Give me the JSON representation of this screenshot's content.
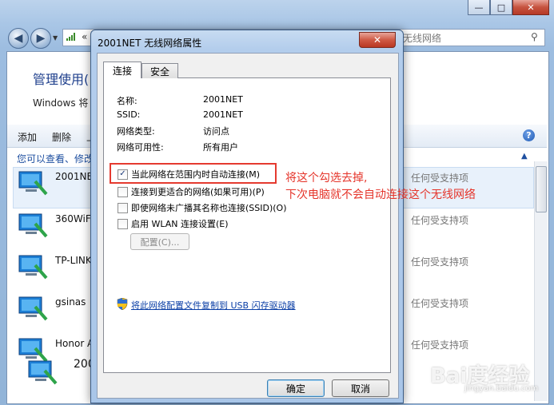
{
  "background": {
    "address_text": "«",
    "search_placeholder": "无线网络",
    "page_title": "管理使用(",
    "subtitle": "Windows 将",
    "toolbar": {
      "add": "添加",
      "remove": "删除",
      "more": "上"
    },
    "hint": "您可以查看、修改",
    "networks": [
      {
        "name": "2001NE",
        "status": "任何受支持项"
      },
      {
        "name": "360WiFi",
        "status": "任何受支持项"
      },
      {
        "name": "TP-LINK",
        "status": "任何受支持项"
      },
      {
        "name": "gsinas",
        "status": "任何受支持项"
      },
      {
        "name": "Honor A",
        "status": "任何受支持项"
      },
      {
        "name": "200",
        "status": ""
      }
    ]
  },
  "dialog": {
    "title": "2001NET 无线网络属性",
    "tabs": [
      "连接",
      "安全"
    ],
    "properties": [
      {
        "label": "名称:",
        "value": "2001NET"
      },
      {
        "label": "SSID:",
        "value": "2001NET"
      },
      {
        "label": "网络类型:",
        "value": "访问点"
      },
      {
        "label": "网络可用性:",
        "value": "所有用户"
      }
    ],
    "options": [
      {
        "label": "当此网络在范围内时自动连接(M)",
        "checked": true
      },
      {
        "label": "连接到更适合的网络(如果可用)(P)",
        "checked": false
      },
      {
        "label": "即使网络未广播其名称也连接(SSID)(O)",
        "checked": false
      },
      {
        "label": "启用 WLAN 连接设置(E)",
        "checked": false
      }
    ],
    "configure_button": "配置(C)...",
    "copy_link": "将此网络配置文件复制到 USB 闪存驱动器",
    "ok_button": "确定",
    "cancel_button": "取消",
    "close_glyph": "✕"
  },
  "annotation": {
    "line1": "将这个勾选去掉,",
    "line2": "下次电脑就不会自动连接这个无线网络",
    "color": "#e5342a"
  },
  "watermark": {
    "text": "Bai度经验",
    "sub": "jingyan.baidu.com"
  },
  "icons": [
    "back-icon",
    "forward-icon",
    "search-icon",
    "help-icon",
    "wireless-network-icon",
    "shield-icon",
    "close-icon"
  ]
}
